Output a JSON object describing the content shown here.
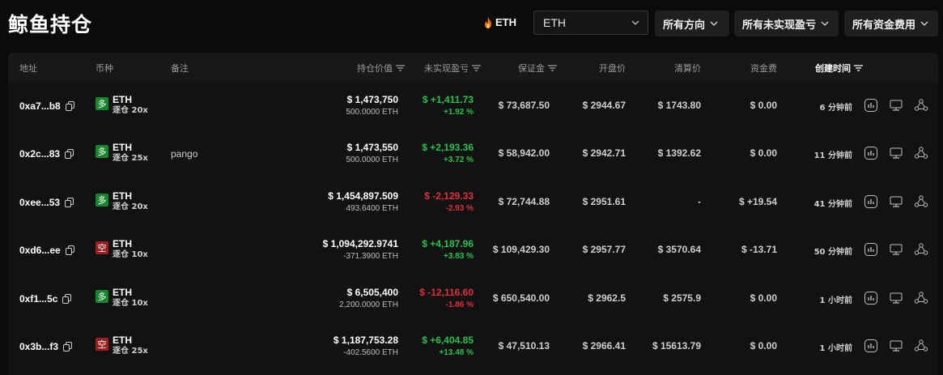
{
  "header": {
    "title": "鲸鱼持仓",
    "coin_pill": "ETH",
    "coin_select": {
      "value": "ETH",
      "icon": "chevron-down-icon"
    },
    "filters": [
      {
        "label": "所有方向"
      },
      {
        "label": "所有未实现盈亏"
      },
      {
        "label": "所有资金费用"
      }
    ]
  },
  "columns": {
    "address": "地址",
    "coin": "币种",
    "note": "备注",
    "position_value": "持仓价值",
    "unrealized_pnl": "未实现盈亏",
    "margin": "保证金",
    "open_price": "开盘价",
    "liq_price": "清算价",
    "funding": "资金费",
    "created": "创建时间"
  },
  "colors": {
    "long": "#17852e",
    "short": "#9b1f1f",
    "positive": "#27c24a",
    "negative": "#e0303a",
    "background": "#0b0b0b"
  },
  "rows": [
    {
      "address": "0xa7...b8",
      "side": "多",
      "side_type": "long",
      "coin": "ETH",
      "leverage": "逐仓 20x",
      "note": "",
      "value": "$ 1,473,750",
      "size": "500.0000 ETH",
      "pnl": "$ +1,411.73",
      "pnl_pct": "+1.92 %",
      "pnl_sign": "pos",
      "margin": "$ 73,687.50",
      "open": "$ 2944.67",
      "liq": "$ 1743.80",
      "funding": "$ 0.00",
      "funding_sign": "",
      "created": "6 分钟前"
    },
    {
      "address": "0x2c...83",
      "side": "多",
      "side_type": "long",
      "coin": "ETH",
      "leverage": "逐仓 25x",
      "note": "pango",
      "value": "$ 1,473,550",
      "size": "500.0000 ETH",
      "pnl": "$ +2,193.36",
      "pnl_pct": "+3.72 %",
      "pnl_sign": "pos",
      "margin": "$ 58,942.00",
      "open": "$ 2942.71",
      "liq": "$ 1392.62",
      "funding": "$ 0.00",
      "funding_sign": "",
      "created": "11 分钟前"
    },
    {
      "address": "0xee...53",
      "side": "多",
      "side_type": "long",
      "coin": "ETH",
      "leverage": "逐仓 20x",
      "note": "",
      "value": "$ 1,454,897.509",
      "size": "493.6400 ETH",
      "pnl": "$ -2,129.33",
      "pnl_pct": "-2.93 %",
      "pnl_sign": "neg",
      "margin": "$ 72,744.88",
      "open": "$ 2951.61",
      "liq": "-",
      "funding": "$ +19.54",
      "funding_sign": "pos",
      "created": "41 分钟前"
    },
    {
      "address": "0xd6...ee",
      "side": "空",
      "side_type": "short",
      "coin": "ETH",
      "leverage": "逐仓 10x",
      "note": "",
      "value": "$ 1,094,292.9741",
      "size": "-371.3900 ETH",
      "pnl": "$ +4,187.96",
      "pnl_pct": "+3.83 %",
      "pnl_sign": "pos",
      "margin": "$ 109,429.30",
      "open": "$ 2957.77",
      "liq": "$ 3570.64",
      "funding": "$ -13.71",
      "funding_sign": "neg",
      "created": "50 分钟前"
    },
    {
      "address": "0xf1...5c",
      "side": "多",
      "side_type": "long",
      "coin": "ETH",
      "leverage": "逐仓 10x",
      "note": "",
      "value": "$ 6,505,400",
      "size": "2,200.0000 ETH",
      "pnl": "$ -12,116.60",
      "pnl_pct": "-1.86 %",
      "pnl_sign": "neg",
      "margin": "$ 650,540.00",
      "open": "$ 2962.5",
      "liq": "$ 2575.9",
      "funding": "$ 0.00",
      "funding_sign": "",
      "created": "1 小时前"
    },
    {
      "address": "0x3b...f3",
      "side": "空",
      "side_type": "short",
      "coin": "ETH",
      "leverage": "逐仓 25x",
      "note": "",
      "value": "$ 1,187,753.28",
      "size": "-402.5600 ETH",
      "pnl": "$ +6,404.85",
      "pnl_pct": "+13.48 %",
      "pnl_sign": "pos",
      "margin": "$ 47,510.13",
      "open": "$ 2966.41",
      "liq": "$ 15613.79",
      "funding": "$ 0.00",
      "funding_sign": "",
      "created": "1 小时前"
    }
  ],
  "row_actions": [
    "chart-icon",
    "monitor-icon",
    "share-icon"
  ]
}
